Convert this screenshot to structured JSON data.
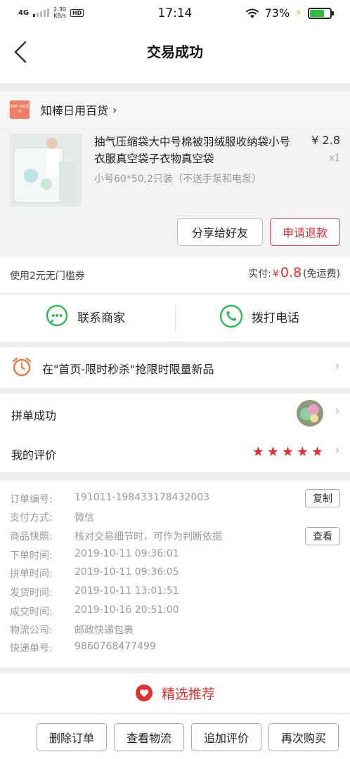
{
  "status_bar": {
    "network": "4G",
    "speed": "2.30",
    "speed_unit": "KB/s",
    "hd": "HD",
    "time": "17:14",
    "battery": "73%",
    "battery_fraction": 0.73
  },
  "header": {
    "title": "交易成功"
  },
  "store": {
    "logo_text": "知棒 日用百货",
    "name": "知棒日用百货",
    "chevron": "›"
  },
  "product": {
    "title": "抽气压缩袋大中号棉被羽绒服收纳袋小号衣服真空袋子衣物真空袋",
    "spec": "小号60*50,2只装（不送手泵和电泵）",
    "price": "¥ 2.8",
    "quantity": "x1",
    "share_label": "分享给好友",
    "refund_label": "申请退款"
  },
  "payment": {
    "coupon": "使用2元无门槛券",
    "paid_label": "实付:",
    "currency": "¥",
    "paid_amount": "0.8",
    "shipping_note": "(免运费)"
  },
  "contact": {
    "merchant_label": "联系商家",
    "phone_label": "拨打电话"
  },
  "promo": {
    "text": "在\"首页-限时秒杀\"抢限时限量新品"
  },
  "group": {
    "label": "拼单成功"
  },
  "review": {
    "label": "我的评价",
    "stars": 5
  },
  "order_details": {
    "rows": [
      {
        "key": "订单编号:",
        "value": "191011-198433178432003"
      },
      {
        "key": "支付方式:",
        "value": "微信"
      },
      {
        "key": "商品快照:",
        "value": "核对交易细节时，可作为判断依据"
      },
      {
        "key": "下单时间:",
        "value": "2019-10-11 09:36:01"
      },
      {
        "key": "拼单时间:",
        "value": "2019-10-11 09:36:05"
      },
      {
        "key": "发货时间:",
        "value": "2019-10-11 13:01:51"
      },
      {
        "key": "成交时间:",
        "value": "2019-10-16 20:51:00"
      },
      {
        "key": "物流公司:",
        "value": "邮政快递包裹"
      },
      {
        "key": "快递单号:",
        "value": "9860768477499"
      }
    ],
    "copy_label": "复制",
    "view_label": "查看"
  },
  "recommend": {
    "label": "精选推荐"
  },
  "bottom_bar": {
    "delete_label": "删除订单",
    "logistics_label": "查看物流",
    "add_review_label": "追加评价",
    "buy_again_label": "再次购买"
  },
  "colors": {
    "accent_red": "#e0302f",
    "wechat_green": "#2dbb55",
    "battery_green": "#2fbf3a"
  }
}
